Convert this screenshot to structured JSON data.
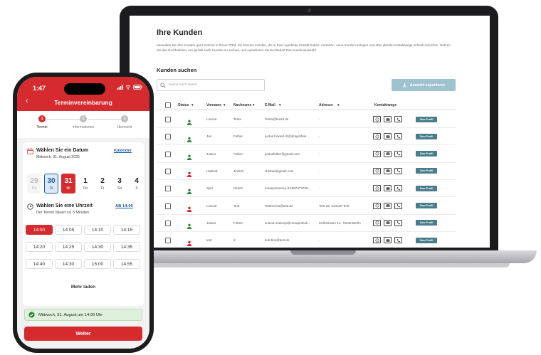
{
  "laptop": {
    "title": "Ihre Kunden",
    "description": "Verwalten Sie Ihre Kunden ganz einfach in Ihrem CRM. Sie können Kunden, die in Ihrer Apotheke bestellt haben, einsehen, neue Kunden anlegen und über direkte Kontaktwege schnell erreichen. Nutzen Sie die Suchfunktion, um gezielt nach Kunden zu suchen, und exportieren Sie bei Bedarf Ihre Kundenauswahl.",
    "search_title": "Kunden suchen",
    "search_placeholder": "Suche nach Name",
    "export_label": "Auswahl exportieren",
    "columns": [
      "Status",
      "Vorname",
      "Nachname",
      "E-Mail",
      "Adresse",
      "Kontaktwege"
    ],
    "profile_label": "Zum Profil",
    "rows": [
      {
        "status": "green",
        "vorname": "Lorena",
        "nachname": "Testa",
        "email": "Testa@teestt.de",
        "adresse": "-"
      },
      {
        "status": "green",
        "vorname": "Jan",
        "nachname": "Felber",
        "email": "justus.hoxied+2@ihrapothek...",
        "adresse": "-"
      },
      {
        "status": "green",
        "vorname": "Justus",
        "nachname": "Felber",
        "email": "justusfelber@gmail.com",
        "adresse": "-"
      },
      {
        "status": "red",
        "vorname": "Hatsedi",
        "nachname": "Jinaleh",
        "email": "shtstaa@gmail.com",
        "adresse": "-"
      },
      {
        "status": "green",
        "vorname": "Sjira",
        "nachname": "Dimitri",
        "email": "mesepotvaceq+14987473728...",
        "adresse": "-"
      },
      {
        "status": "red",
        "vorname": "Lorena",
        "nachname": "Test",
        "email": "Testlorena@test.de",
        "adresse": "Test 23, 344340 Test"
      },
      {
        "status": "green",
        "vorname": "Justus",
        "nachname": "Felber",
        "email": "Justus.noelexpi@neuapothek...",
        "adresse": "Kohlstrasse 12, 75048 Berlin"
      },
      {
        "status": "red",
        "vorname": "test",
        "nachname": "d",
        "email": "test.bmi@test.de",
        "adresse": "-"
      }
    ],
    "colors": {
      "export": "#9fc2cf",
      "profile": "#4a7d8c",
      "green": "#2e8b3a",
      "red": "#d52b2f"
    }
  },
  "phone": {
    "time": "1:47",
    "title": "Terminvereinbarung",
    "steps": [
      {
        "num": "1",
        "label": "Termin",
        "active": true
      },
      {
        "num": "2",
        "label": "Informationen",
        "active": false
      },
      {
        "num": "3",
        "label": "Übersicht",
        "active": false
      }
    ],
    "date_title": "Wählen Sie ein Datum",
    "date_sub": "Mittwoch, 31. August 2025",
    "calendar_link": "Kalender",
    "days": [
      {
        "n": "29",
        "w": "Mo",
        "state": "past"
      },
      {
        "n": "30",
        "w": "Di",
        "state": "today"
      },
      {
        "n": "31",
        "w": "Mi",
        "state": "selected"
      },
      {
        "n": "1",
        "w": "Do",
        "state": "normal"
      },
      {
        "n": "2",
        "w": "Fr",
        "state": "normal"
      },
      {
        "n": "3",
        "w": "Sa",
        "state": "normal"
      },
      {
        "n": "4",
        "w": "S",
        "state": "normal"
      }
    ],
    "time_title": "Wählen Sie eine Uhrzeit",
    "time_sub": "Der Termin dauert ca. 5 Minuten",
    "time_link": "AB 14:00",
    "slots": [
      "14:00",
      "14:05",
      "14:10",
      "14:15",
      "14:20",
      "14:25",
      "14:30",
      "14:35",
      "14:40",
      "14:30",
      "15:00",
      "14:55"
    ],
    "selected_slot": 0,
    "more_label": "Mehr laden",
    "confirm_text": "Mittwoch, 31. August um 14:00 Uhr",
    "cta": "Weiter",
    "colors": {
      "brand": "#d52b2f",
      "link": "#1e5aa8",
      "confirm_bg": "#dff1dc"
    }
  }
}
